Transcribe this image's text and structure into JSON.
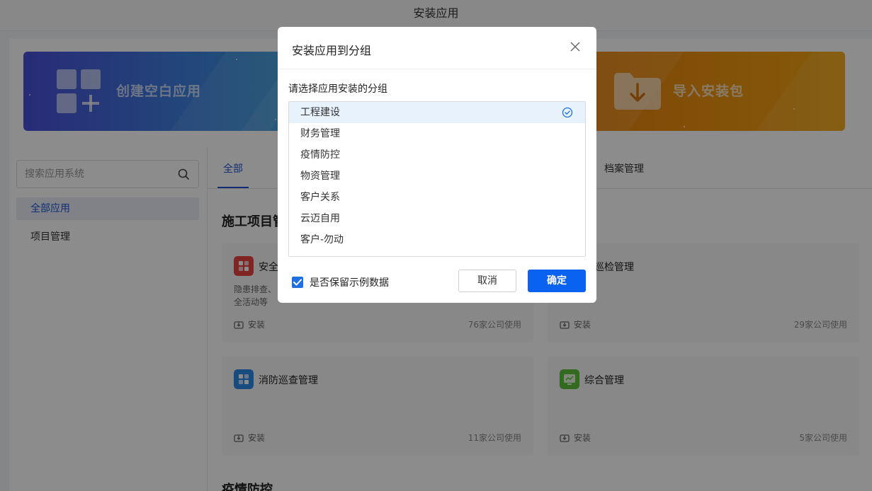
{
  "topbar": {
    "title": "安装应用"
  },
  "banners": {
    "create_label": "创建空白应用",
    "import_label": "导入安装包"
  },
  "sidebar": {
    "search_placeholder": "搜索应用系统",
    "items": [
      {
        "label": "全部应用",
        "active": true
      },
      {
        "label": "项目管理",
        "active": false
      }
    ]
  },
  "tabs": [
    {
      "label": "全部",
      "active": true
    },
    {
      "label": "档案管理",
      "active": false
    }
  ],
  "sections": [
    {
      "title": "施工项目管"
    },
    {
      "title": "疫情防控"
    }
  ],
  "cards": [
    {
      "name": "安全",
      "desc": "隐患排查、\n全活动等",
      "install": "安装",
      "usage": "76家公司使用",
      "icon_color": "#e94040"
    },
    {
      "name": "备巡检管理",
      "desc": "",
      "install": "安装",
      "usage": "29家公司使用",
      "icon_color": "#e94040"
    },
    {
      "name": "消防巡查管理",
      "desc": "",
      "install": "安装",
      "usage": "11家公司使用",
      "icon_color": "#2f8ae5"
    },
    {
      "name": "综合管理",
      "desc": "",
      "install": "安装",
      "usage": "5家公司使用",
      "icon_color": "#5cc23a"
    }
  ],
  "modal": {
    "title": "安装应用到分组",
    "label": "请选择应用安装的分组",
    "groups": [
      {
        "label": "工程建设",
        "selected": true
      },
      {
        "label": "财务管理",
        "selected": false
      },
      {
        "label": "疫情防控",
        "selected": false
      },
      {
        "label": "物资管理",
        "selected": false
      },
      {
        "label": "客户关系",
        "selected": false
      },
      {
        "label": "云迈自用",
        "selected": false
      },
      {
        "label": "客户-勿动",
        "selected": false
      }
    ],
    "keep_data_label": "是否保留示例数据",
    "keep_data_checked": true,
    "cancel_label": "取消",
    "ok_label": "确定"
  },
  "colors": {
    "primary": "#0a63f0",
    "accent_blue": "#1f55d6",
    "banner_left": "#4a4fd8",
    "banner_right": "#f2a513"
  }
}
